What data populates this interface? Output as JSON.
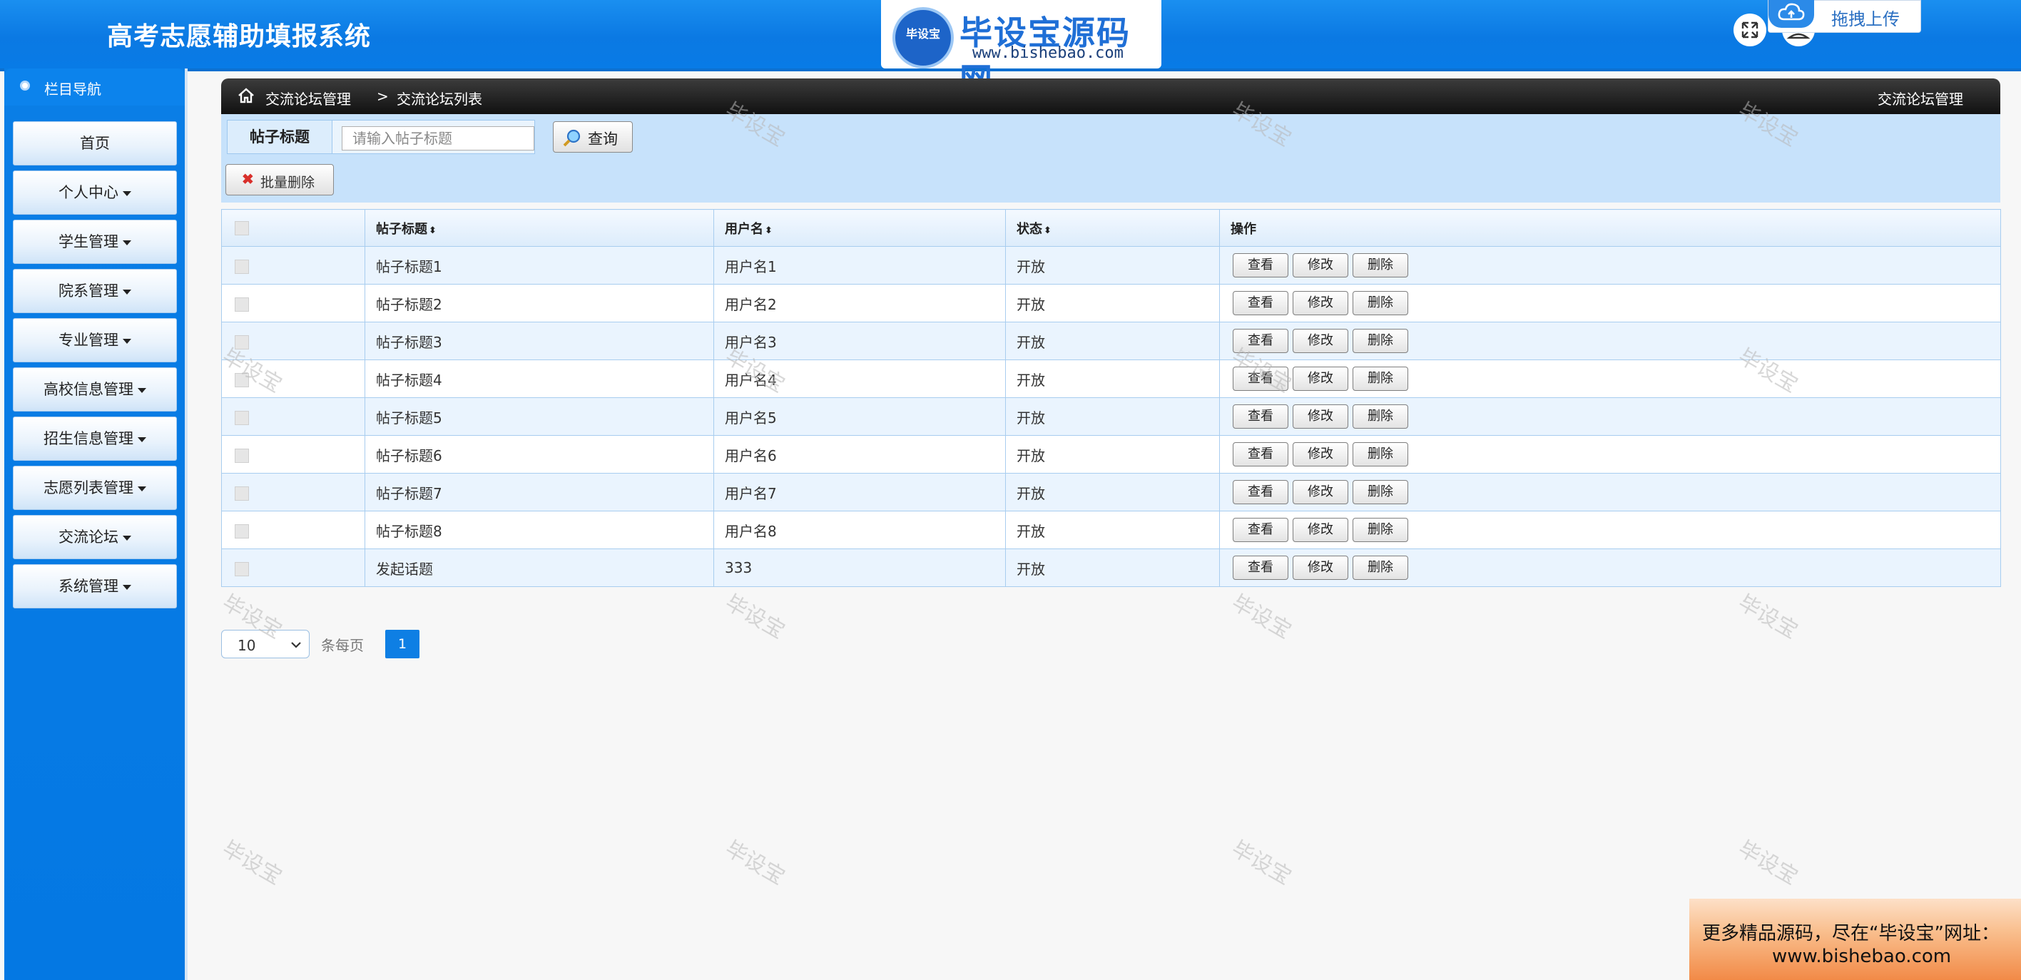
{
  "header": {
    "app_title": "高考志愿辅助填报系统",
    "brand": {
      "emblem_text": "毕设宝",
      "name": "毕设宝源码网",
      "url": "www.bishebao.com"
    },
    "upload_label": "拖拽上传"
  },
  "sidebar": {
    "title": "栏目导航",
    "items": [
      {
        "label": "首页",
        "has_caret": false
      },
      {
        "label": "个人中心",
        "has_caret": true
      },
      {
        "label": "学生管理",
        "has_caret": true
      },
      {
        "label": "院系管理",
        "has_caret": true
      },
      {
        "label": "专业管理",
        "has_caret": true
      },
      {
        "label": "高校信息管理",
        "has_caret": true
      },
      {
        "label": "招生信息管理",
        "has_caret": true
      },
      {
        "label": "志愿列表管理",
        "has_caret": true
      },
      {
        "label": "交流论坛",
        "has_caret": true
      },
      {
        "label": "系统管理",
        "has_caret": true
      }
    ]
  },
  "breadcrumb": {
    "module": "交流论坛管理",
    "separator": ">",
    "page": "交流论坛列表",
    "right_title": "交流论坛管理"
  },
  "search": {
    "label": "帖子标题",
    "placeholder": "请输入帖子标题",
    "query_label": "查询",
    "batch_delete_label": "批量删除"
  },
  "table": {
    "columns": [
      "帖子标题",
      "用户名",
      "状态",
      "操作"
    ],
    "actions": [
      "查看",
      "修改",
      "删除"
    ],
    "rows": [
      {
        "title": "帖子标题1",
        "user": "用户名1",
        "status": "开放"
      },
      {
        "title": "帖子标题2",
        "user": "用户名2",
        "status": "开放"
      },
      {
        "title": "帖子标题3",
        "user": "用户名3",
        "status": "开放"
      },
      {
        "title": "帖子标题4",
        "user": "用户名4",
        "status": "开放"
      },
      {
        "title": "帖子标题5",
        "user": "用户名5",
        "status": "开放"
      },
      {
        "title": "帖子标题6",
        "user": "用户名6",
        "status": "开放"
      },
      {
        "title": "帖子标题7",
        "user": "用户名7",
        "status": "开放"
      },
      {
        "title": "帖子标题8",
        "user": "用户名8",
        "status": "开放"
      },
      {
        "title": "发起话题",
        "user": "333",
        "status": "开放"
      }
    ]
  },
  "pagination": {
    "page_size": "10",
    "per_page_label": "条每页",
    "current_page": "1"
  },
  "watermark_text": "毕设宝",
  "ad": {
    "line1": "更多精品源码，尽在“毕设宝”网址：",
    "line2": "www.bishebao.com"
  },
  "colors": {
    "header_blue": "#0b79e3",
    "sidebar_blue": "#0478e3",
    "panel_blue": "#c7e2fb",
    "active_page": "#0e7fe4"
  }
}
